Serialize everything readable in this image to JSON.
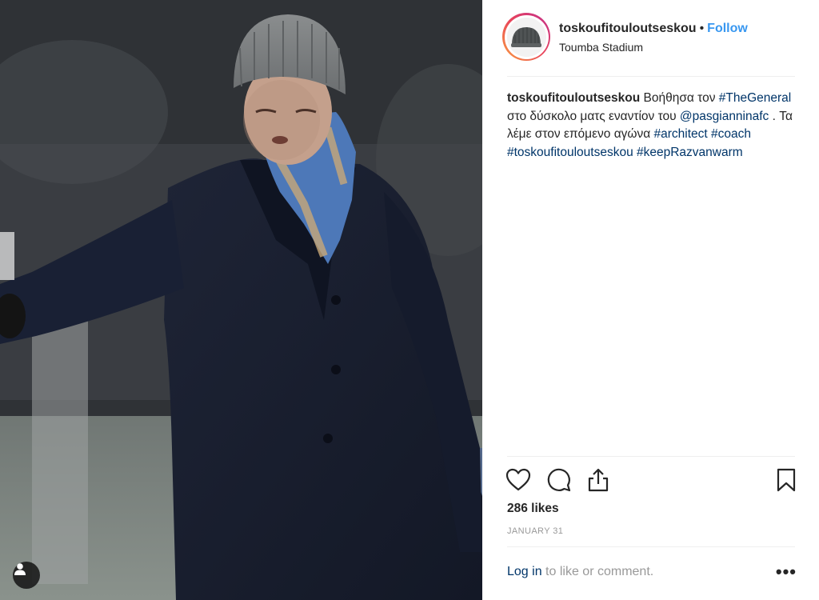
{
  "post": {
    "username": "toskoufitouloutseskou",
    "separator": "•",
    "follow_label": "Follow",
    "location": "Toumba Stadium",
    "caption": {
      "username": "toskoufitouloutseskou",
      "text_1": "Βοήθησα τον",
      "tag_1": "#TheGeneral",
      "text_2": "στο δύσκολο ματς εναντίον του",
      "mention": "@pasgianninafc",
      "text_3": ". Τα λέμε στον επόμενο αγώνα",
      "tag_2": "#architect",
      "tag_3": "#coach",
      "tag_4": "#toskoufitouloutseskou",
      "tag_5": "#keepRazvanwarm"
    },
    "likes": "286 likes",
    "date": "JANUARY 31",
    "login_label": "Log in",
    "login_suffix": "to like or comment.",
    "more_label": "•••"
  },
  "icons": {
    "like": "heart-icon",
    "comment": "comment-icon",
    "share": "share-icon",
    "save": "bookmark-icon",
    "tagged_user": "user-icon"
  },
  "colors": {
    "link": "#003569",
    "follow": "#3897f0",
    "muted": "#999999",
    "text": "#262626"
  }
}
